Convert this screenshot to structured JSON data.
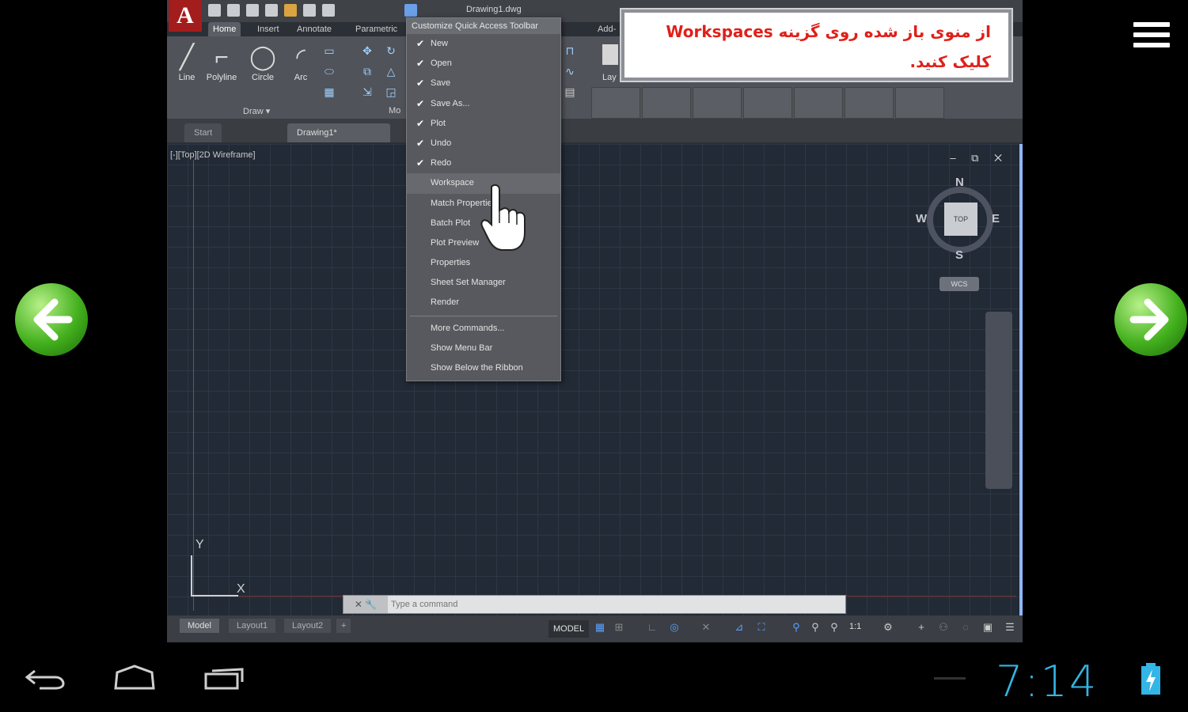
{
  "app": {
    "doc_title": "Drawing1.dwg",
    "logo_letter": "A",
    "ribbon_tabs": [
      "Home",
      "Insert",
      "Annotate",
      "Parametric",
      "Add-ins"
    ],
    "tools": [
      {
        "label": "Line",
        "glyph": "╱"
      },
      {
        "label": "Polyline",
        "glyph": "⌐"
      },
      {
        "label": "Circle",
        "glyph": "◯"
      },
      {
        "label": "Arc",
        "glyph": "◜"
      }
    ],
    "draw_panel_label": "Draw ▾",
    "panel_label_2": "Mo",
    "layer_label": "Lay",
    "file_tabs": [
      "Start",
      "Drawing1*"
    ],
    "viewport_label": "[-][Top][2D Wireframe]",
    "viewport_controls": "–  ⧉  ✕",
    "ucs_x": "X",
    "ucs_y": "Y",
    "viewcube": {
      "top": "TOP",
      "n": "N",
      "s": "S",
      "e": "E",
      "w": "W",
      "wcs": "WCS"
    },
    "command_line_placeholder": "Type a command",
    "layout_tabs": [
      "Model",
      "Layout1",
      "Layout2",
      "+"
    ],
    "status_model": "MODEL",
    "status_scale": "1:1"
  },
  "qat_menu": {
    "header": "Customize Quick Access Toolbar",
    "items": [
      {
        "label": "New",
        "checked": true
      },
      {
        "label": "Open",
        "checked": true
      },
      {
        "label": "Save",
        "checked": true
      },
      {
        "label": "Save As...",
        "checked": true
      },
      {
        "label": "Plot",
        "checked": true
      },
      {
        "label": "Undo",
        "checked": true
      },
      {
        "label": "Redo",
        "checked": true
      },
      {
        "label": "Workspace",
        "checked": false
      },
      {
        "label": "Match Properties",
        "checked": false
      },
      {
        "label": "Batch Plot",
        "checked": false
      },
      {
        "label": "Plot Preview",
        "checked": false
      },
      {
        "label": "Properties",
        "checked": false
      },
      {
        "label": "Sheet Set Manager",
        "checked": false
      },
      {
        "label": "Render",
        "checked": false
      }
    ],
    "extra_items": [
      "More Commands...",
      "Show Menu Bar",
      "Show Below the Ribbon"
    ]
  },
  "callout": {
    "line1": "از منوی باز شده روی گزینه Workspaces",
    "line2": "کلیک کنید."
  },
  "system": {
    "clock": "7:14"
  },
  "icons": {
    "menu": "hamburger-icon",
    "prev": "arrow-left-icon",
    "next": "arrow-right-icon",
    "back": "back-icon",
    "home": "home-icon",
    "recents": "recents-icon",
    "battery": "battery-charging-icon"
  },
  "colors": {
    "callout_text": "#e0201a",
    "clock": "#33b5e5",
    "arrow_green": "#43b01d"
  }
}
